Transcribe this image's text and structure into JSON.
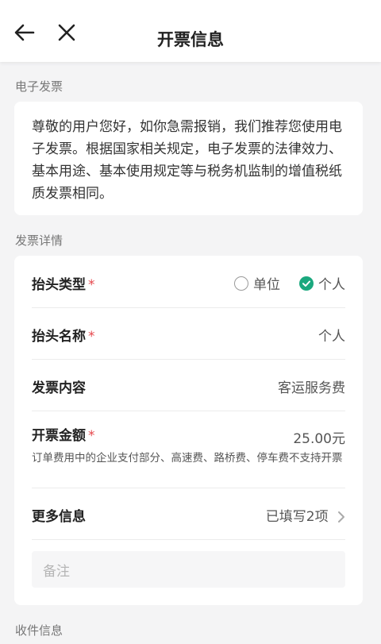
{
  "header": {
    "title": "开票信息"
  },
  "sections": {
    "e_invoice_label": "电子发票",
    "detail_label": "发票详情",
    "shipping_label": "收件信息"
  },
  "notice": {
    "text": "尊敬的用户您好，如你急需报销，我们推荐您使用电子发票。根据国家相关规定，电子发票的法律效力、基本用途、基本使用规定等与税务机监制的增值税纸质发票相同。"
  },
  "form": {
    "title_type": {
      "label": "抬头类型",
      "options": [
        "单位",
        "个人"
      ],
      "selected": "个人"
    },
    "title_name": {
      "label": "抬头名称",
      "value": "个人"
    },
    "content": {
      "label": "发票内容",
      "value": "客运服务费"
    },
    "amount": {
      "label": "开票金额",
      "value": "25.00元",
      "note": "订单费用中的企业支付部分、高速费、路桥费、停车费不支持开票"
    },
    "more": {
      "label": "更多信息",
      "value": "已填写2项"
    },
    "remark": {
      "placeholder": "备注"
    },
    "required_mark": "*"
  },
  "colors": {
    "accent": "#1aa87e",
    "required": "#e5484d"
  },
  "icons": {
    "back": "arrow-left-icon",
    "close": "close-icon",
    "check": "check-circle-icon",
    "chevron": "chevron-right-icon"
  }
}
